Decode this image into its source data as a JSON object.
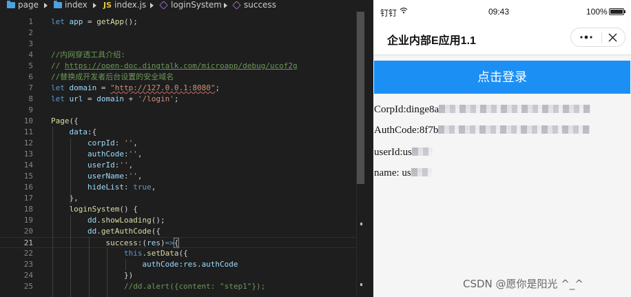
{
  "editor": {
    "breadcrumb": [
      "page",
      "index",
      "index.js",
      "loginSystem",
      "success"
    ],
    "js_badge": "JS",
    "lines": [
      {
        "n": "1",
        "tokens": [
          [
            "kw",
            "let"
          ],
          [
            "pl",
            " "
          ],
          [
            "pr",
            "app"
          ],
          [
            "pl",
            " = "
          ],
          [
            "fn",
            "getApp"
          ],
          [
            "pl",
            "();"
          ]
        ]
      },
      {
        "n": "2",
        "tokens": []
      },
      {
        "n": "3",
        "tokens": []
      },
      {
        "n": "4",
        "tokens": [
          [
            "cm",
            "//内网穿透工具介绍:"
          ]
        ]
      },
      {
        "n": "5",
        "tokens": [
          [
            "cm",
            "// "
          ],
          [
            "cm url-ul",
            "https://open-doc.dingtalk.com/microapp/debug/ucof2g"
          ]
        ]
      },
      {
        "n": "6",
        "tokens": [
          [
            "cm",
            "//替换成开发者后台设置的安全域名"
          ]
        ]
      },
      {
        "n": "7",
        "tokens": [
          [
            "kw",
            "let"
          ],
          [
            "pl",
            " "
          ],
          [
            "pr",
            "domain"
          ],
          [
            "pl",
            " = "
          ],
          [
            "st squig",
            "\"http://127.0.0.1:8080\""
          ],
          [
            "pl",
            ";"
          ]
        ]
      },
      {
        "n": "8",
        "tokens": [
          [
            "kw",
            "let"
          ],
          [
            "pl",
            " "
          ],
          [
            "pr",
            "url"
          ],
          [
            "pl",
            " = "
          ],
          [
            "pr",
            "domain"
          ],
          [
            "pl",
            " + "
          ],
          [
            "st",
            "'/login'"
          ],
          [
            "pl",
            ";"
          ]
        ]
      },
      {
        "n": "9",
        "tokens": []
      },
      {
        "n": "10",
        "tokens": [
          [
            "fn",
            "Page"
          ],
          [
            "pl",
            "({"
          ]
        ]
      },
      {
        "n": "11",
        "tokens": [
          [
            "pl",
            "    "
          ],
          [
            "pr",
            "data"
          ],
          [
            "pl",
            ":{"
          ]
        ]
      },
      {
        "n": "12",
        "tokens": [
          [
            "pl",
            "        "
          ],
          [
            "pr",
            "corpId"
          ],
          [
            "pl",
            ": "
          ],
          [
            "st",
            "''"
          ],
          [
            "pl",
            ","
          ]
        ]
      },
      {
        "n": "13",
        "tokens": [
          [
            "pl",
            "        "
          ],
          [
            "pr",
            "authCode"
          ],
          [
            "pl",
            ":"
          ],
          [
            "st",
            "''"
          ],
          [
            "pl",
            ","
          ]
        ]
      },
      {
        "n": "14",
        "tokens": [
          [
            "pl",
            "        "
          ],
          [
            "pr",
            "userId"
          ],
          [
            "pl",
            ":"
          ],
          [
            "st",
            "''"
          ],
          [
            "pl",
            ","
          ]
        ]
      },
      {
        "n": "15",
        "tokens": [
          [
            "pl",
            "        "
          ],
          [
            "pr",
            "userName"
          ],
          [
            "pl",
            ":"
          ],
          [
            "st",
            "''"
          ],
          [
            "pl",
            ","
          ]
        ]
      },
      {
        "n": "16",
        "tokens": [
          [
            "pl",
            "        "
          ],
          [
            "pr",
            "hideList"
          ],
          [
            "pl",
            ": "
          ],
          [
            "kw",
            "true"
          ],
          [
            "pl",
            ","
          ]
        ]
      },
      {
        "n": "17",
        "tokens": [
          [
            "pl",
            "    },"
          ]
        ]
      },
      {
        "n": "18",
        "tokens": [
          [
            "pl",
            "    "
          ],
          [
            "fn",
            "loginSystem"
          ],
          [
            "pl",
            "() {"
          ]
        ]
      },
      {
        "n": "19",
        "tokens": [
          [
            "pl",
            "        "
          ],
          [
            "pr",
            "dd"
          ],
          [
            "pl",
            "."
          ],
          [
            "fn",
            "showLoading"
          ],
          [
            "pl",
            "();"
          ]
        ]
      },
      {
        "n": "20",
        "tokens": [
          [
            "pl",
            "        "
          ],
          [
            "pr",
            "dd"
          ],
          [
            "pl",
            "."
          ],
          [
            "fn",
            "getAuthCode"
          ],
          [
            "pl",
            "({"
          ]
        ]
      },
      {
        "n": "21",
        "tokens": [
          [
            "pl",
            "            "
          ],
          [
            "fn",
            "success"
          ],
          [
            "pl",
            ":("
          ],
          [
            "pr",
            "res"
          ],
          [
            "pl",
            ")"
          ],
          [
            "kw",
            "=>"
          ],
          [
            "pl cur-tok",
            "{"
          ]
        ]
      },
      {
        "n": "22",
        "tokens": [
          [
            "pl",
            "                "
          ],
          [
            "kw",
            "this"
          ],
          [
            "pl",
            "."
          ],
          [
            "fn",
            "setData"
          ],
          [
            "pl",
            "({"
          ]
        ]
      },
      {
        "n": "23",
        "tokens": [
          [
            "pl",
            "                    "
          ],
          [
            "pr",
            "authCode"
          ],
          [
            "pl",
            ":"
          ],
          [
            "pr",
            "res"
          ],
          [
            "pl",
            "."
          ],
          [
            "pr",
            "authCode"
          ]
        ]
      },
      {
        "n": "24",
        "tokens": [
          [
            "pl",
            "                })"
          ]
        ]
      },
      {
        "n": "25",
        "tokens": [
          [
            "pl",
            "                "
          ],
          [
            "cm",
            "//dd.alert({content: \"step1\"});"
          ]
        ]
      }
    ],
    "active_line": "21"
  },
  "phone": {
    "status": {
      "carrier": "钉钉",
      "time": "09:43",
      "battery": "100%"
    },
    "battery_level": 1.0,
    "title": "企业内部E应用1.1",
    "login_button": "点击登录",
    "info": [
      {
        "label": "CorpId:",
        "value": "dinge8a"
      },
      {
        "label": "AuthCode:",
        "value": "8f7b"
      },
      {
        "label": "userId:",
        "value": "us"
      },
      {
        "label": "name: ",
        "value": "us"
      }
    ],
    "watermark": "CSDN @愿你是阳光 ^_^"
  },
  "colors": {
    "accent": "#1c8ff5",
    "editor_bg": "#1e1e1e"
  },
  "icons": [
    "folder-icon",
    "chevron-right-icon",
    "js-file-icon",
    "method-cube-icon",
    "wifi-icon",
    "battery-icon",
    "more-icon",
    "close-icon"
  ]
}
